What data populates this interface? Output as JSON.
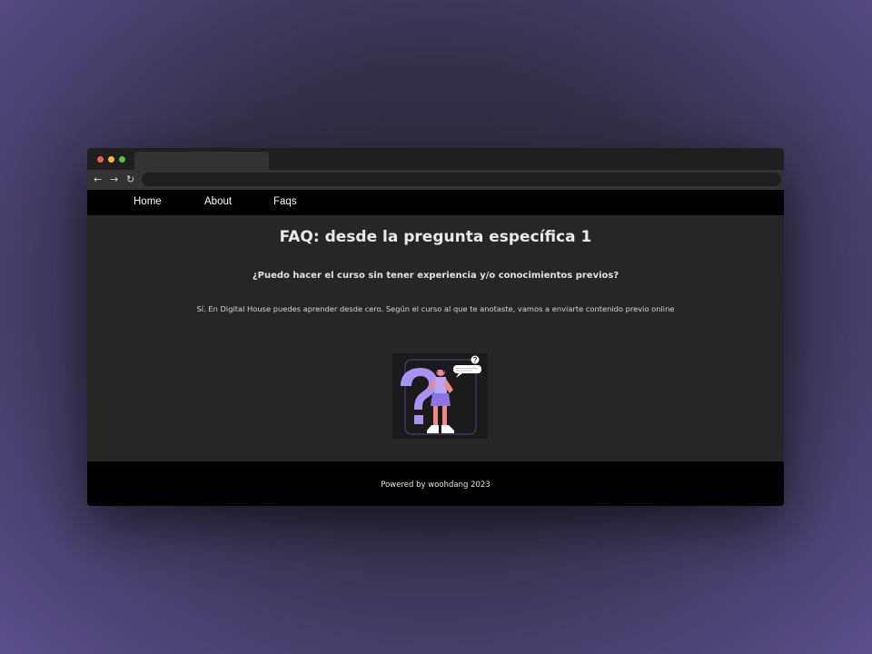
{
  "browser": {
    "back_icon": "arrow-left-icon",
    "forward_icon": "arrow-right-icon",
    "reload_icon": "reload-icon",
    "back_glyph": "←",
    "forward_glyph": "→",
    "reload_glyph": "↻",
    "url": ""
  },
  "nav": {
    "items": [
      {
        "label": "Home"
      },
      {
        "label": "About"
      },
      {
        "label": "Faqs"
      }
    ]
  },
  "main": {
    "title": "FAQ: desde la pregunta específica 1",
    "question": "¿Puedo hacer el curso sin tener experiencia y/o conocimientos previos?",
    "answer": "Sí. En Digital House puedes aprender desde cero. Según el curso al que te anotaste, vamos a enviarte contenido previo online",
    "illustration_icon": "question-mark-person-illustration"
  },
  "footer": {
    "text": "Powered by woohdang 2023"
  },
  "colors": {
    "accent": "#a993f2",
    "navbar": "#000000",
    "content_bg": "#262626",
    "footer": "#000000"
  }
}
